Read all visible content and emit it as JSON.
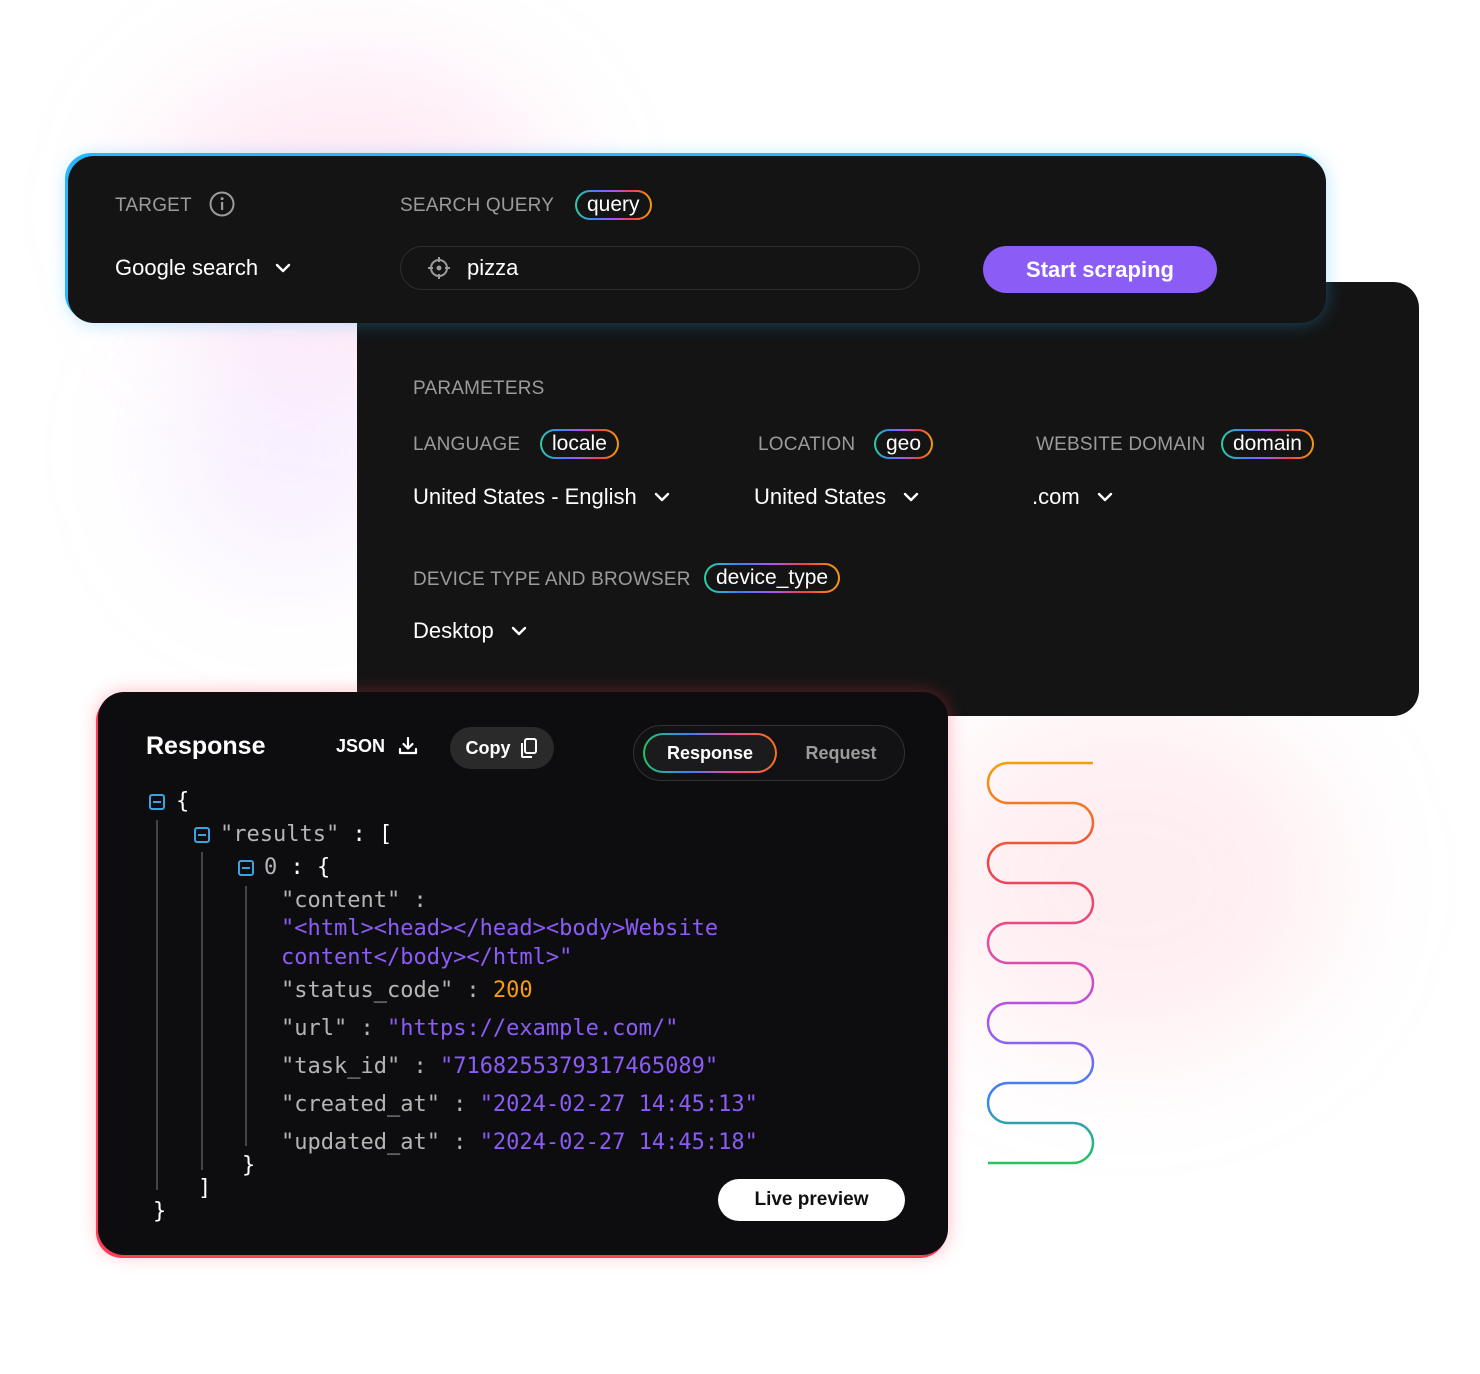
{
  "target": {
    "label": "TARGET",
    "value": "Google search"
  },
  "search_query": {
    "label": "SEARCH QUERY",
    "tag": "query",
    "value": "pizza"
  },
  "start_button": "Start scraping",
  "parameters": {
    "label": "PARAMETERS",
    "language": {
      "label": "LANGUAGE",
      "tag": "locale",
      "value": "United States - English"
    },
    "location": {
      "label": "LOCATION",
      "tag": "geo",
      "value": "United States"
    },
    "website_domain": {
      "label": "WEBSITE DOMAIN",
      "tag": "domain",
      "value": ".com"
    },
    "device": {
      "label": "DEVICE TYPE AND BROWSER",
      "tag": "device_type",
      "value": "Desktop"
    }
  },
  "response": {
    "title": "Response",
    "json_label": "JSON",
    "copy_label": "Copy",
    "tabs": {
      "active": "Response",
      "inactive": "Request"
    },
    "live_preview": "Live preview",
    "code": {
      "open_brace": "{",
      "results_key": "\"results\"",
      "colon_bracket": " : [",
      "index_key": "0",
      "colon_brace": " : {",
      "content_key": "\"content\" :",
      "content_line1": "\"<html><head></head><body>Website",
      "content_line2": "content</body></html>\"",
      "status_key": "\"status_code\" :",
      "status_value": "200",
      "url_key": "\"url\" :",
      "url_value": "\"https://example.com/\"",
      "task_key": "\"task_id\" :",
      "task_value": "\"7168255379317465089\"",
      "created_key": "\"created_at\" :",
      "created_value": "\"2024-02-27 14:45:13\"",
      "updated_key": "\"updated_at\" :",
      "updated_value": "\"2024-02-27 14:45:18\"",
      "close_obj": "}",
      "close_arr": "]",
      "close_root": "}"
    }
  },
  "colors": {
    "accent": "#8b5cf6",
    "panel": "#141414",
    "number": "#f59e0b"
  }
}
